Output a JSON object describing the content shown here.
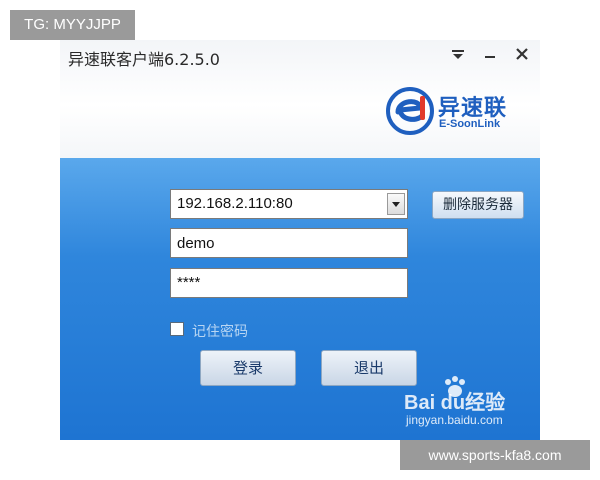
{
  "overlay": {
    "top_tag": "TG: MYYJJPP",
    "bottom_tag": "www.sports-kfa8.com"
  },
  "window": {
    "title": "异速联客户端6.2.5.0",
    "controls": [
      "menu-icon",
      "minimize-icon",
      "close-icon"
    ]
  },
  "brand": {
    "name": "异速联",
    "subtitle": "E-SoonLink",
    "logo_letter": "e"
  },
  "login": {
    "server_value": "192.168.2.110:80",
    "username_value": "demo",
    "password_value": "****",
    "delete_server_label": "删除服务器",
    "remember_label": "记住密码",
    "remember_checked": false,
    "login_label": "登录",
    "exit_label": "退出"
  },
  "watermark": {
    "main": "Bai du经验",
    "sub": "jingyan.baidu.com"
  },
  "colors": {
    "body_blue": "#2f86dc",
    "brand_blue": "#1f5fbf",
    "logo_red": "#e23a2a"
  }
}
